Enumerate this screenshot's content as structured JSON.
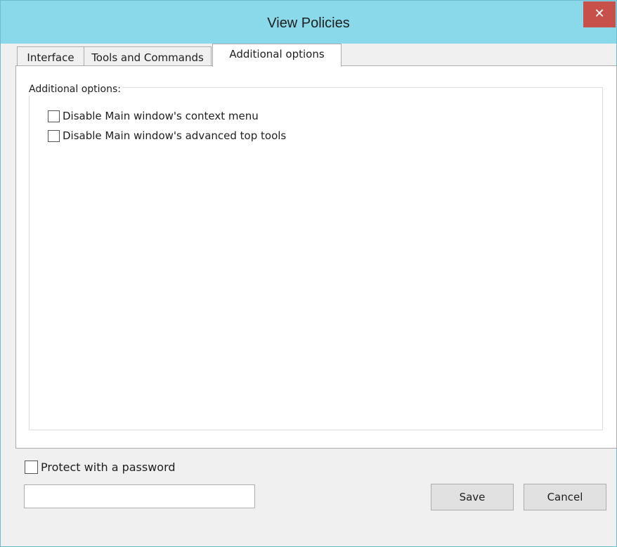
{
  "window": {
    "title": "View Policies",
    "close_glyph": "✕",
    "close_icon": "close-icon",
    "close_color": "#c7504a",
    "titlebar_color": "#89d9ea"
  },
  "tabs": [
    {
      "label": "Interface",
      "active": false
    },
    {
      "label": "Tools and Commands",
      "active": false
    },
    {
      "label": "Additional options",
      "active": true
    }
  ],
  "group": {
    "legend": "Additional options:",
    "options": [
      {
        "label": "Disable Main window's context menu",
        "checked": false
      },
      {
        "label": "Disable Main window's advanced top tools",
        "checked": false
      }
    ]
  },
  "footer": {
    "protect_label": "Protect with a password",
    "protect_checked": false,
    "password_value": "",
    "save_label": "Save",
    "cancel_label": "Cancel"
  }
}
